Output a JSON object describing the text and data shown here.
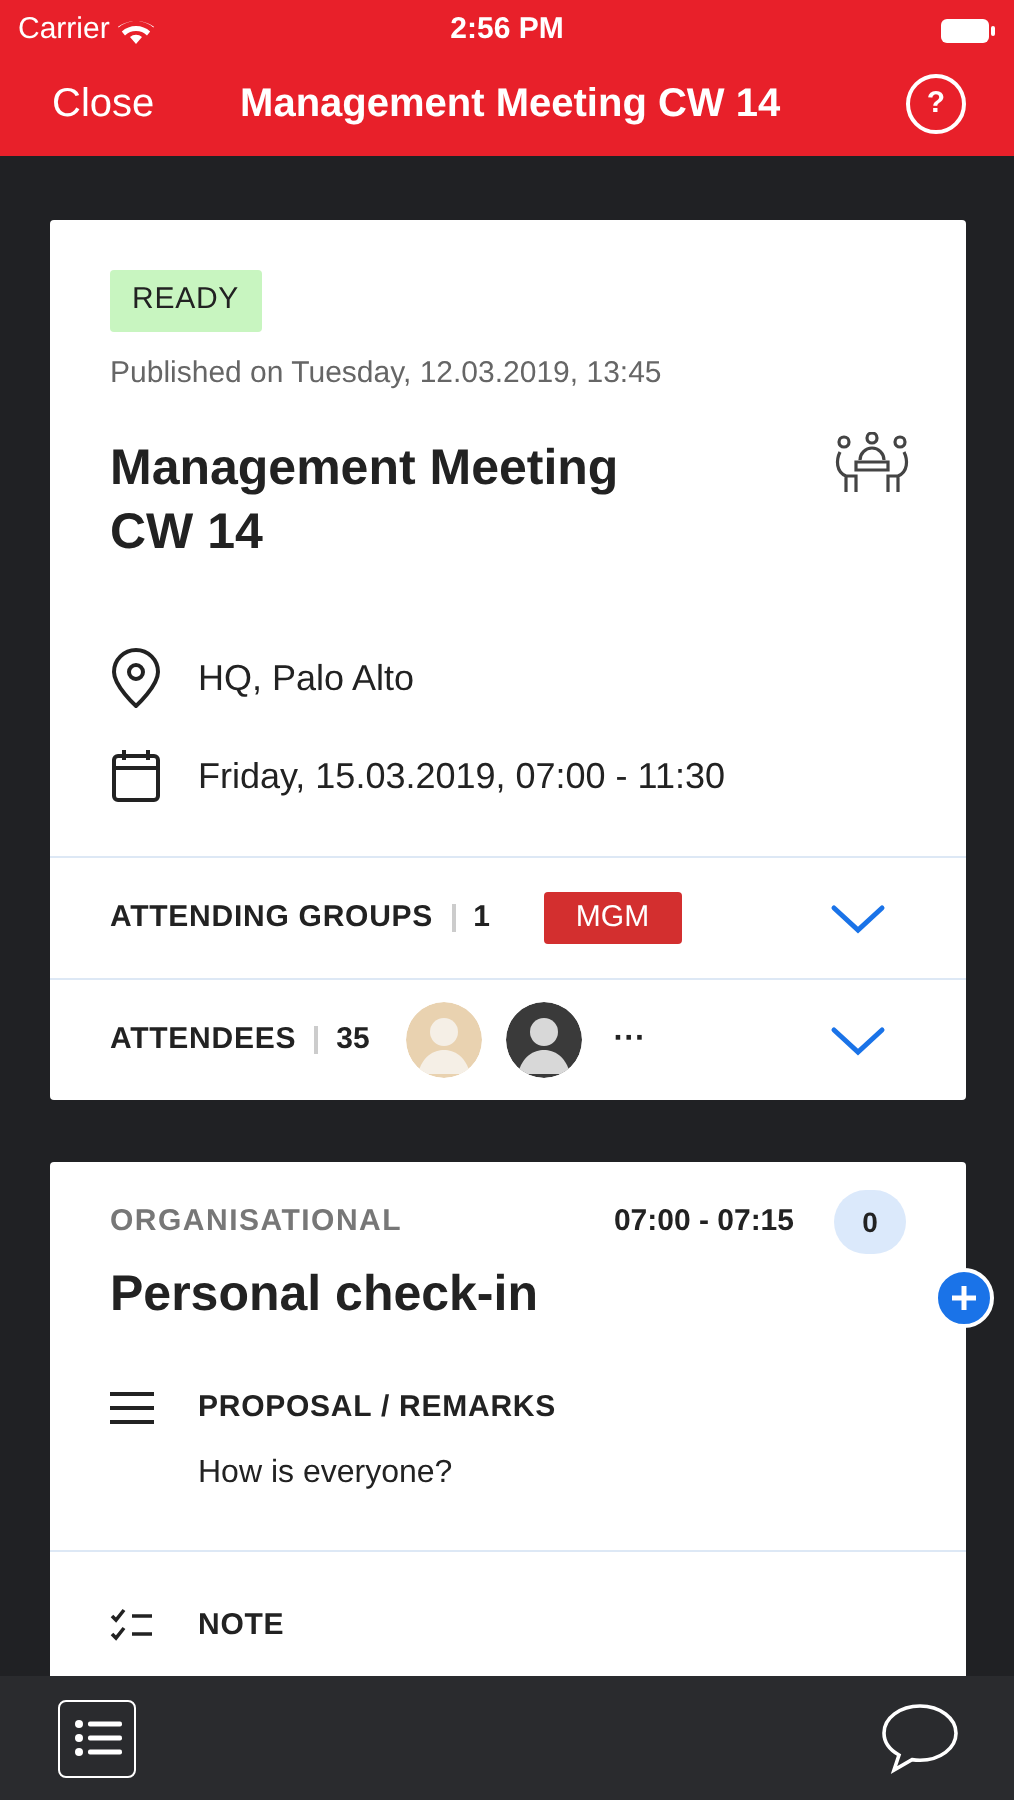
{
  "status_bar": {
    "carrier": "Carrier",
    "time": "2:56 PM"
  },
  "nav": {
    "close": "Close",
    "title": "Management Meeting CW 14",
    "help": "?"
  },
  "meeting": {
    "status": "READY",
    "published": "Published on Tuesday, 12.03.2019, 13:45",
    "title": "Management Meeting CW 14",
    "location": "HQ, Palo Alto",
    "date": "Friday, 15.03.2019, 07:00 - 11:30",
    "sections": [
      {
        "kind": "groups",
        "label": "ATTENDING GROUPS",
        "count": "1",
        "tags": [
          {
            "text": "MGM",
            "color": "#d32f2f"
          }
        ],
        "expanded": false
      },
      {
        "kind": "attendees",
        "label": "ATTENDEES",
        "count": "35",
        "avatars": [
          {
            "kind": "light"
          },
          {
            "kind": "dark"
          }
        ],
        "more": "···",
        "expanded": false
      }
    ]
  },
  "agenda_item": {
    "category": "ORGANISATIONAL",
    "time": "07:00 - 07:15",
    "comments": "0",
    "title": "Personal check-in",
    "fields": [
      {
        "kind": "text",
        "label": "PROPOSAL / REMARKS",
        "value": "How is everyone?"
      },
      {
        "kind": "checklist",
        "label": "NOTE"
      }
    ]
  }
}
